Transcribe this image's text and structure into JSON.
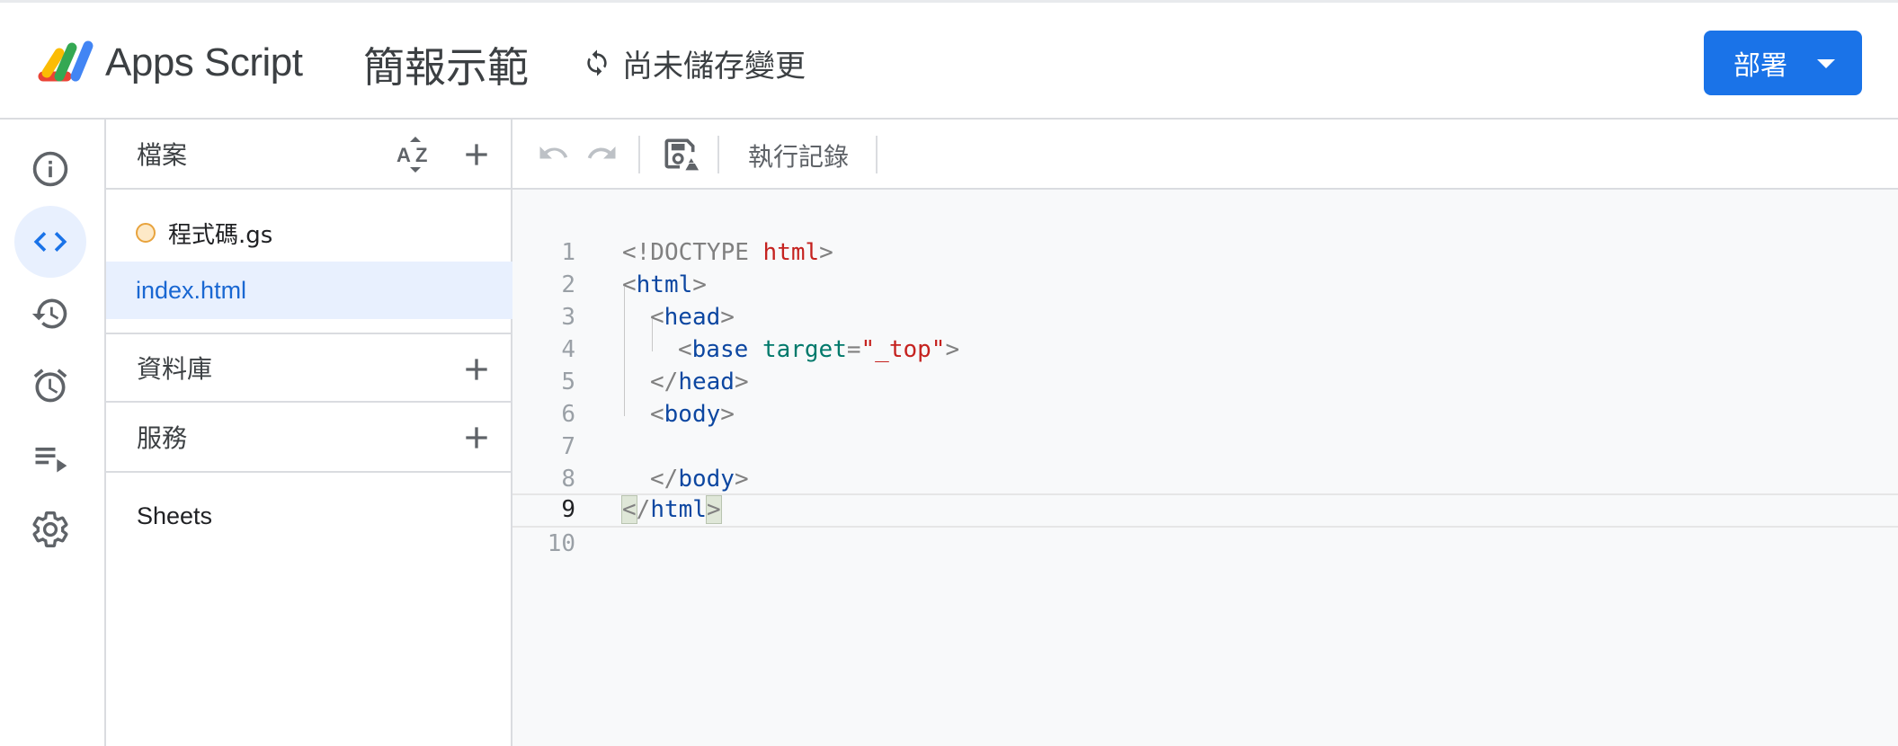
{
  "header": {
    "app_name": "Apps Script",
    "project_title": "簡報示範",
    "save_status": "尚未儲存變更",
    "deploy_label": "部署"
  },
  "rail": {
    "items": [
      {
        "name": "overview",
        "icon": "info-icon",
        "active": false
      },
      {
        "name": "editor",
        "icon": "code-icon",
        "active": true
      },
      {
        "name": "project-history",
        "icon": "history-icon",
        "active": false
      },
      {
        "name": "triggers",
        "icon": "alarm-icon",
        "active": false
      },
      {
        "name": "executions",
        "icon": "executions-icon",
        "active": false
      },
      {
        "name": "settings",
        "icon": "gear-icon",
        "active": false
      }
    ],
    "accent": "#1a73e8"
  },
  "files_panel": {
    "files_title": "檔案",
    "files": [
      {
        "name": "程式碼.gs",
        "selected": false
      },
      {
        "name": "index.html",
        "selected": true
      }
    ],
    "libraries_title": "資料庫",
    "services_title": "服務",
    "services": [
      "Sheets"
    ]
  },
  "toolbar": {
    "execution_log_label": "執行記錄"
  },
  "editor": {
    "current_line": 9,
    "lines": [
      {
        "n": "1"
      },
      {
        "n": "2"
      },
      {
        "n": "3"
      },
      {
        "n": "4"
      },
      {
        "n": "5"
      },
      {
        "n": "6"
      },
      {
        "n": "7"
      },
      {
        "n": "8"
      },
      {
        "n": "9"
      },
      {
        "n": "10"
      }
    ],
    "tokens": {
      "l1_a": "<!DOCTYPE ",
      "l1_b": "html",
      "l1_c": ">",
      "l2_a": "<",
      "l2_b": "html",
      "l2_c": ">",
      "l3_a": "<",
      "l3_b": "head",
      "l3_c": ">",
      "l4_a": "<",
      "l4_b": "base",
      "l4_c": " ",
      "l4_d": "target",
      "l4_e": "=",
      "l4_f": "\"_top\"",
      "l4_g": ">",
      "l5_a": "</",
      "l5_b": "head",
      "l5_c": ">",
      "l6_a": "<",
      "l6_b": "body",
      "l6_c": ">",
      "l8_a": "</",
      "l8_b": "body",
      "l8_c": ">",
      "l9_a": "<",
      "l9_b": "/",
      "l9_c": "html",
      "l9_d": ">"
    }
  }
}
